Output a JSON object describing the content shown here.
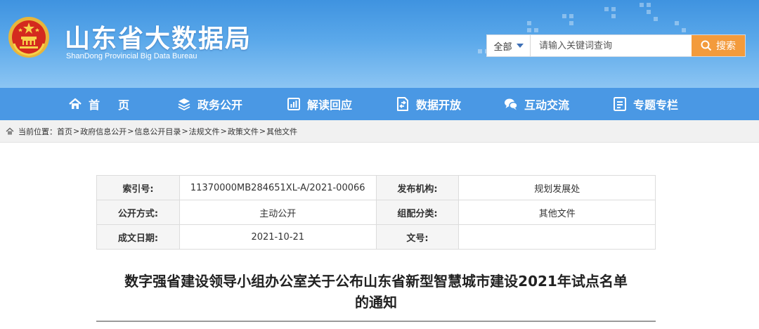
{
  "site": {
    "title": "山东省大数据局",
    "subtitle": "ShanDong Provincial Big Data Bureau"
  },
  "search": {
    "scope": "全部",
    "placeholder": "请输入关键词查询",
    "button": "搜索",
    "button_color": "#f39b3c"
  },
  "nav": {
    "items": [
      {
        "label": "首页",
        "icon": "home-icon"
      },
      {
        "label": "政务公开",
        "icon": "stack-icon"
      },
      {
        "label": "解读回应",
        "icon": "document-chart-icon"
      },
      {
        "label": "数据开放",
        "icon": "data-file-icon"
      },
      {
        "label": "互动交流",
        "icon": "chat-icon"
      },
      {
        "label": "专题专栏",
        "icon": "list-board-icon"
      }
    ],
    "bg_color": "#4a98e4"
  },
  "breadcrumb": {
    "prefix": "当前位置：",
    "items": [
      "首页",
      "政府信息公开",
      "信息公开目录",
      "法规文件",
      "政策文件",
      "其他文件"
    ],
    "separator": ">"
  },
  "info": {
    "rows": [
      {
        "k1": "索引号:",
        "v1": "11370000MB284651XL-A/2021-00066",
        "k2": "发布机构:",
        "v2": "规划发展处"
      },
      {
        "k1": "公开方式:",
        "v1": "主动公开",
        "k2": "组配分类:",
        "v2": "其他文件"
      },
      {
        "k1": "成文日期:",
        "v1": "2021-10-21",
        "k2": "文号:",
        "v2": ""
      }
    ]
  },
  "article": {
    "title_line1": "数字强省建设领导小组办公室关于公布山东省新型智慧城市建设2021年试点名单",
    "title_line2": "的通知"
  },
  "colors": {
    "header_top": "#3f93e0",
    "header_bottom": "#8cc5f3",
    "accent": "#f39b3c"
  }
}
